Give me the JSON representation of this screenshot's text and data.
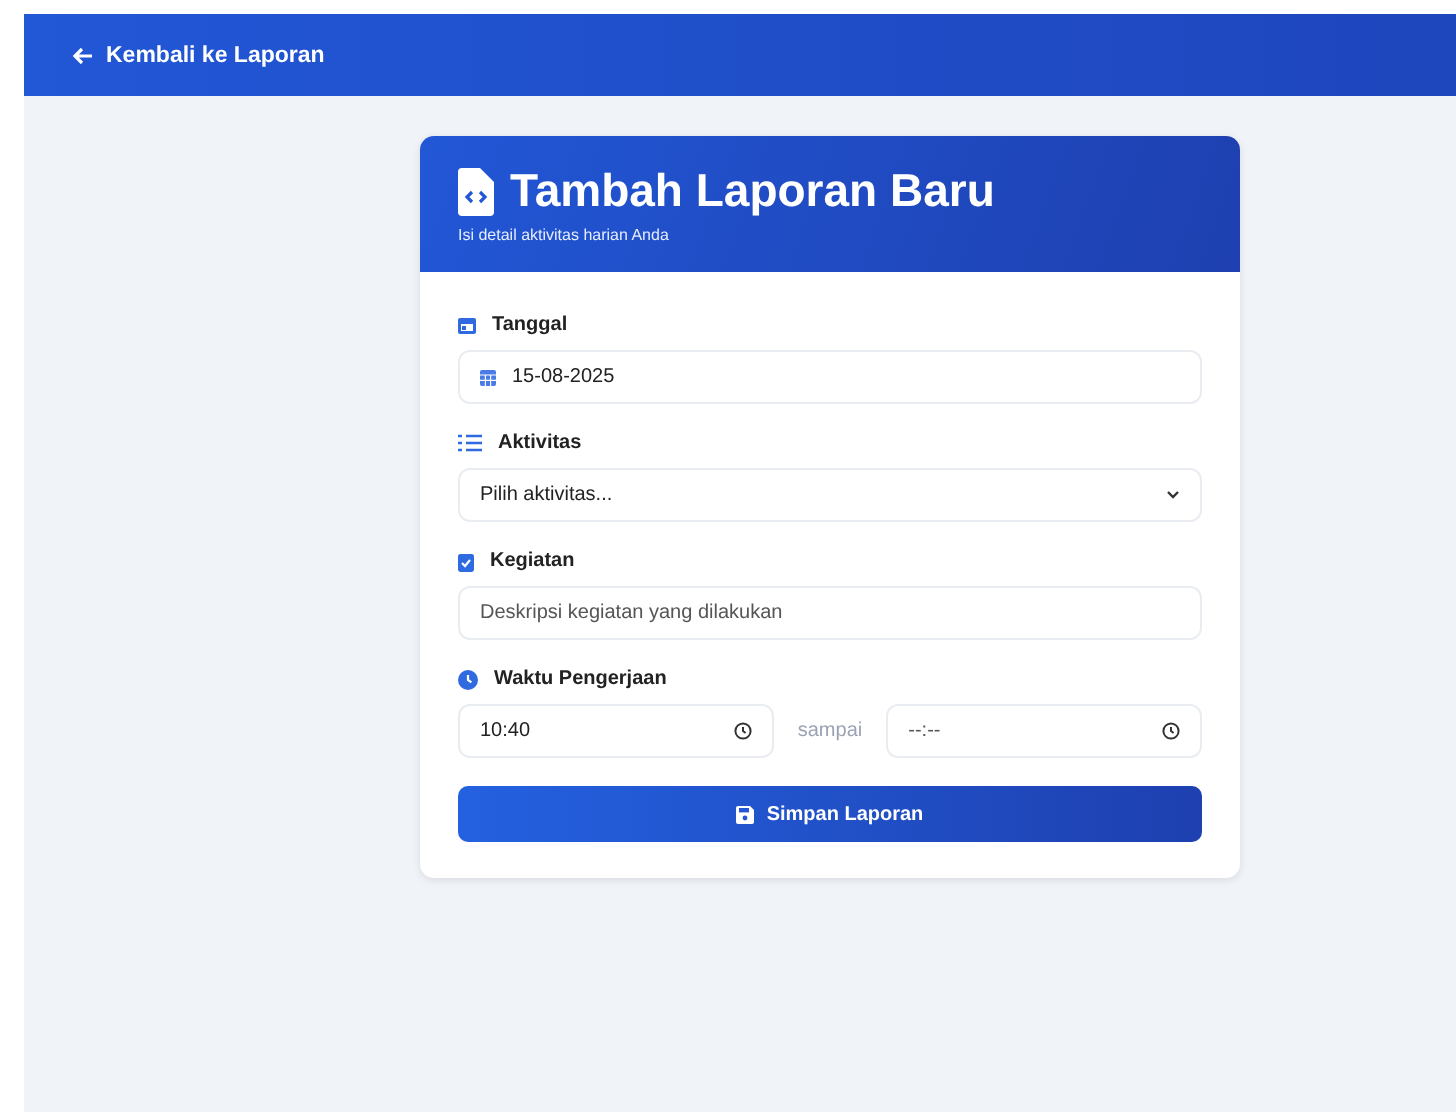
{
  "top_bar": {
    "back_link": "Kembali ke Laporan"
  },
  "card": {
    "title": "Tambah Laporan Baru",
    "subtitle": "Isi detail aktivitas harian Anda"
  },
  "fields": [
    {
      "kind": "date",
      "label": "Tanggal",
      "value": "15-08-2025"
    },
    {
      "kind": "select",
      "label": "Aktivitas",
      "placeholder": "Pilih aktivitas..."
    },
    {
      "kind": "text",
      "label": "Kegiatan",
      "placeholder": "Deskripsi kegiatan yang dilakukan"
    },
    {
      "kind": "time-range",
      "label": "Waktu Pengerjaan",
      "start": "10:40",
      "separator": "sampai",
      "end": "--:--"
    }
  ],
  "submit_button": "Simpan Laporan"
}
